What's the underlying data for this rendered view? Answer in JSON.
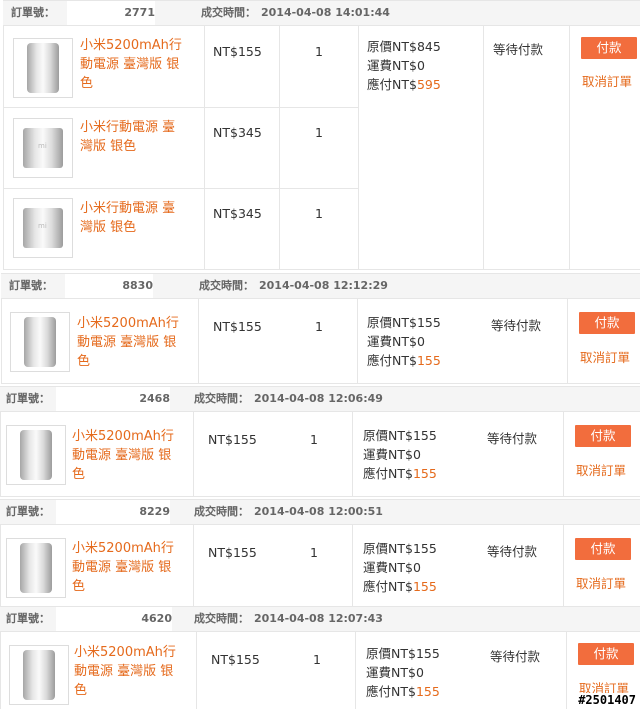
{
  "labels": {
    "order_no": "訂單號：",
    "deal_time": "成交時間：",
    "original": "原價",
    "shipping": "運費",
    "payable": "應付",
    "status": "等待付款",
    "pay": "付款",
    "cancel": "取消訂單"
  },
  "product_names": {
    "p5200": "小米5200mAh行動電源 臺灣版 银色",
    "p10400": "小米行動電源 臺灣版 银色"
  },
  "orders": [
    {
      "id": "2771",
      "time": "2014-04-08 14:01:44",
      "items": [
        {
          "name": "小米5200mAh行動電源 臺灣版 银色",
          "price": "NT$155",
          "qty": "1"
        },
        {
          "name": "小米行動電源 臺灣版 银色",
          "price": "NT$345",
          "qty": "1"
        },
        {
          "name": "小米行動電源 臺灣版 银色",
          "price": "NT$345",
          "qty": "1"
        }
      ],
      "original": "NT$845",
      "shipping": "NT$0",
      "payable": "NT$",
      "payable_amount": "595"
    },
    {
      "id": "8830",
      "time": "2014-04-08 12:12:29",
      "items": [
        {
          "name": "小米5200mAh行動電源 臺灣版 银色",
          "price": "NT$155",
          "qty": "1"
        }
      ],
      "original": "NT$155",
      "shipping": "NT$0",
      "payable": "NT$",
      "payable_amount": "155"
    },
    {
      "id": "2468",
      "time": "2014-04-08 12:06:49",
      "items": [
        {
          "name": "小米5200mAh行動電源 臺灣版 银色",
          "price": "NT$155",
          "qty": "1"
        }
      ],
      "original": "NT$155",
      "shipping": "NT$0",
      "payable": "NT$",
      "payable_amount": "155"
    },
    {
      "id": "8229",
      "time": "2014-04-08 12:00:51",
      "items": [
        {
          "name": "小米5200mAh行動電源 臺灣版 银色",
          "price": "NT$155",
          "qty": "1"
        }
      ],
      "original": "NT$155",
      "shipping": "NT$0",
      "payable": "NT$",
      "payable_amount": "155"
    },
    {
      "id": "4620",
      "time": "2014-04-08 12:07:43",
      "items": [
        {
          "name": "小米5200mAh行動電源 臺灣版 银色",
          "price": "NT$155",
          "qty": "1"
        }
      ],
      "original": "NT$155",
      "shipping": "NT$0",
      "payable": "NT$",
      "payable_amount": "155"
    }
  ],
  "watermark": "#2501407"
}
